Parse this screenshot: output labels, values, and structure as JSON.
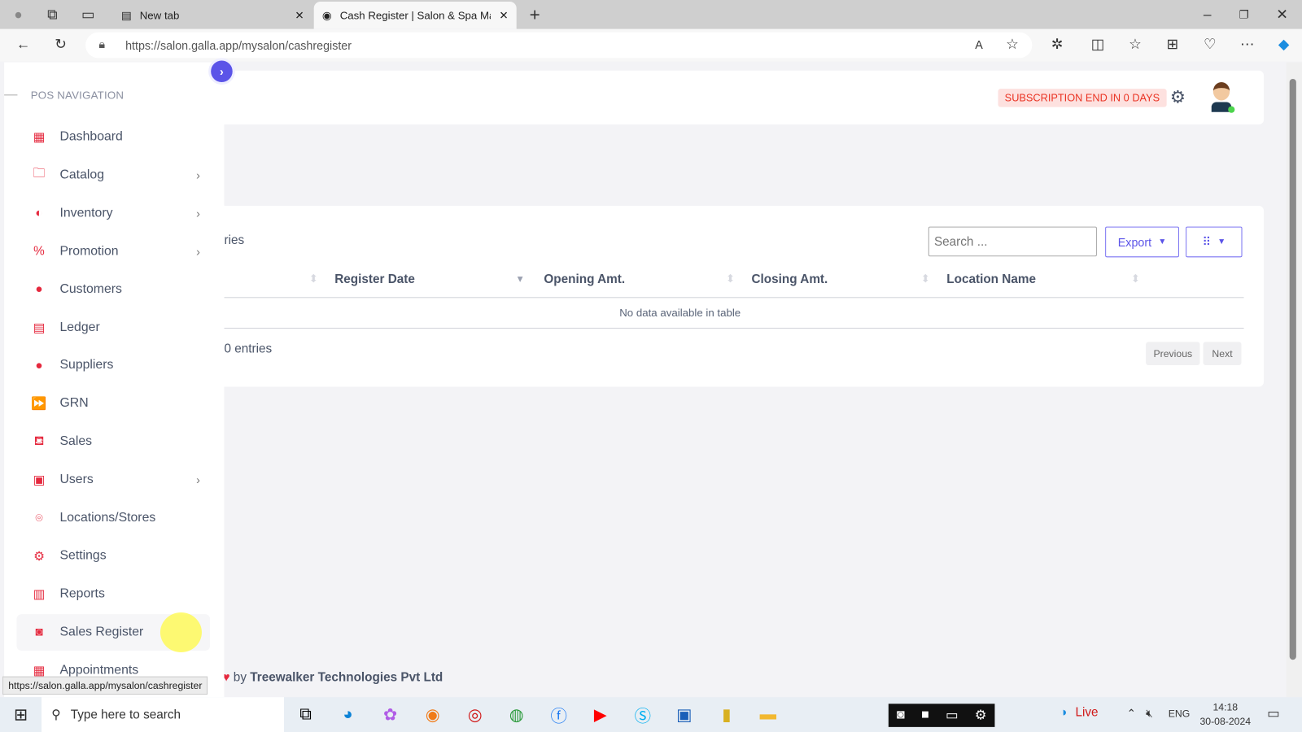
{
  "browser": {
    "tabs": [
      {
        "title": "New tab"
      },
      {
        "title": "Cash Register | Salon & Spa Mana"
      }
    ],
    "url": "https://salon.galla.app/mysalon/cashregister",
    "status_url": "https://salon.galla.app/mysalon/cashregister"
  },
  "sidebar": {
    "header": "POS NAVIGATION",
    "items": [
      {
        "label": "Dashboard",
        "icon": "dashboard-icon",
        "glyph": "▦",
        "chevron": false
      },
      {
        "label": "Catalog",
        "icon": "folder-icon",
        "glyph": "🗀",
        "chevron": true
      },
      {
        "label": "Inventory",
        "icon": "inventory-icon",
        "glyph": "◐",
        "chevron": true
      },
      {
        "label": "Promotion",
        "icon": "ticket-icon",
        "glyph": "%",
        "chevron": true
      },
      {
        "label": "Customers",
        "icon": "user-icon",
        "glyph": "●",
        "chevron": false
      },
      {
        "label": "Ledger",
        "icon": "file-icon",
        "glyph": "▤",
        "chevron": false
      },
      {
        "label": "Suppliers",
        "icon": "user-icon",
        "glyph": "●",
        "chevron": false
      },
      {
        "label": "GRN",
        "icon": "forward-icon",
        "glyph": "⏩",
        "chevron": false
      },
      {
        "label": "Sales",
        "icon": "basket-icon",
        "glyph": "⛾",
        "chevron": false
      },
      {
        "label": "Users",
        "icon": "users-icon",
        "glyph": "▣",
        "chevron": true
      },
      {
        "label": "Locations/Stores",
        "icon": "location-icon",
        "glyph": "⌾",
        "chevron": false
      },
      {
        "label": "Settings",
        "icon": "settings-icon",
        "glyph": "⚙",
        "chevron": false
      },
      {
        "label": "Reports",
        "icon": "report-icon",
        "glyph": "▥",
        "chevron": false
      },
      {
        "label": "Sales Register",
        "icon": "register-icon",
        "glyph": "◙",
        "chevron": false,
        "selected": true
      },
      {
        "label": "Appointments",
        "icon": "calendar-icon",
        "glyph": "▦",
        "chevron": false
      }
    ]
  },
  "header": {
    "subscription_badge": "SUBSCRIPTION END IN 0 DAYS"
  },
  "table": {
    "length_text_partial": "ries",
    "search_placeholder": "Search ...",
    "export_label": "Export",
    "columns": [
      "Register Date",
      "Opening Amt.",
      "Closing Amt.",
      "Location Name"
    ],
    "empty_text": "No data available in table",
    "info_partial": "0 entries",
    "prev_label": "Previous",
    "next_label": "Next"
  },
  "footer": {
    "text": "by ",
    "company": "Treewalker Technologies Pvt Ltd"
  },
  "taskbar": {
    "search_placeholder": "Type here to search",
    "weather": "Live",
    "lang": "ENG",
    "time": "14:18",
    "date": "30-08-2024"
  },
  "colors": {
    "accent": "#5b54e8",
    "danger": "#e5293e",
    "badge_bg": "#fde1df"
  }
}
